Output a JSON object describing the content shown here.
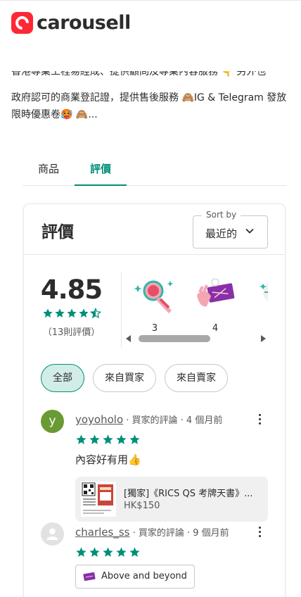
{
  "app": {
    "brand": "carousell",
    "brand_color": "#ff2636",
    "accent": "#008f79"
  },
  "profile": {
    "description_cut": "香港專業工程易經成、提供顧問及專業內容服務 👇 另外也",
    "description": "政府認可的商業登記證，提供售後服務 🙈IG & Telegram 發放限時優惠卷🥵 🙈..."
  },
  "tabs": [
    {
      "label": "商品",
      "active": false
    },
    {
      "label": "評價",
      "active": true
    }
  ],
  "reviews_card": {
    "title": "評價",
    "sort": {
      "label": "Sort by",
      "value": "最近的"
    },
    "rating": {
      "score": "4.85",
      "stars": 4.85,
      "count_text": "（13則評價）"
    },
    "badges": [
      {
        "icon": "magnifier-badge-icon",
        "count": "3"
      },
      {
        "icon": "ticket-badge-icon",
        "count": "4"
      },
      {
        "icon": "badge-icon",
        "count": ""
      }
    ],
    "filters": [
      {
        "label": "全部",
        "active": true
      },
      {
        "label": "來自買家",
        "active": false
      },
      {
        "label": "來自賣家",
        "active": false
      }
    ],
    "reviews": [
      {
        "avatar_letter": "y",
        "avatar_color": "#6a9a33",
        "username": "yoyoholo",
        "meta": " · 買家的評論 · 4 個月前",
        "stars": 5,
        "text": "內容好有用👍",
        "product": {
          "title": "[獨家]《RICS QS 考牌天書》...",
          "price": "HK$150"
        }
      },
      {
        "avatar_letter": "",
        "username": "charles_ss",
        "meta": " · 買家的評論 · 9 個月前",
        "stars": 5,
        "tag": "Above and beyond"
      }
    ]
  }
}
